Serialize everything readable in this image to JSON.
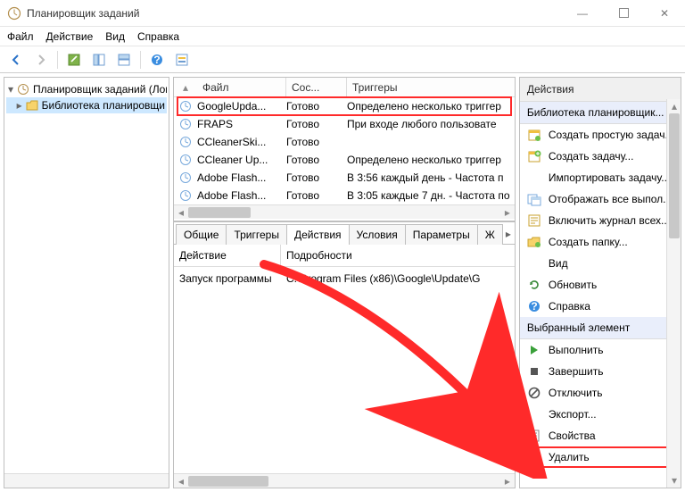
{
  "window": {
    "title": "Планировщик заданий"
  },
  "menu": [
    "Файл",
    "Действие",
    "Вид",
    "Справка"
  ],
  "tree": {
    "root": "Планировщик заданий (Лока",
    "child": "Библиотека планировщи"
  },
  "list": {
    "headers": [
      "Файл",
      "Сос...",
      "Триггеры"
    ],
    "rows": [
      {
        "name": "GoogleUpda...",
        "state": "Готово",
        "trigger": "Определено несколько триггер",
        "selected": true
      },
      {
        "name": "FRAPS",
        "state": "Готово",
        "trigger": "При входе любого пользовате"
      },
      {
        "name": "CCleanerSki...",
        "state": "Готово",
        "trigger": ""
      },
      {
        "name": "CCleaner Up...",
        "state": "Готово",
        "trigger": "Определено несколько триггер"
      },
      {
        "name": "Adobe Flash...",
        "state": "Готово",
        "trigger": "В 3:56 каждый день - Частота п"
      },
      {
        "name": "Adobe Flash...",
        "state": "Готово",
        "trigger": "В 3:05 каждые 7 дн. - Частота по"
      }
    ]
  },
  "tabs": {
    "items": [
      "Общие",
      "Триггеры",
      "Действия",
      "Условия",
      "Параметры",
      "Ж"
    ],
    "active": 2,
    "etc": "▸"
  },
  "detail": {
    "headers": [
      "Действие",
      "Подробности"
    ],
    "row": {
      "action": "Запуск программы",
      "info": "C:\\Program Files (x86)\\Google\\Update\\G"
    }
  },
  "actions": {
    "title": "Действия",
    "group1": {
      "title": "Библиотека планировщик...",
      "items": [
        {
          "icon": "calendar-new",
          "label": "Создать простую задач..."
        },
        {
          "icon": "calendar-plus",
          "label": "Создать задачу..."
        },
        {
          "icon": "blank",
          "label": "Импортировать задачу..."
        },
        {
          "icon": "calendar-all",
          "label": "Отображать все выпол..."
        },
        {
          "icon": "log",
          "label": "Включить журнал всех..."
        },
        {
          "icon": "folder-new",
          "label": "Создать папку..."
        },
        {
          "icon": "blank",
          "label": "Вид",
          "sub": true
        },
        {
          "icon": "refresh",
          "label": "Обновить"
        },
        {
          "icon": "help",
          "label": "Справка"
        }
      ]
    },
    "group2": {
      "title": "Выбранный элемент",
      "items": [
        {
          "icon": "play",
          "label": "Выполнить"
        },
        {
          "icon": "stop",
          "label": "Завершить"
        },
        {
          "icon": "disable",
          "label": "Отключить"
        },
        {
          "icon": "blank",
          "label": "Экспорт..."
        },
        {
          "icon": "props",
          "label": "Свойства"
        },
        {
          "icon": "delete",
          "label": "Удалить",
          "highlight": true
        }
      ]
    }
  }
}
